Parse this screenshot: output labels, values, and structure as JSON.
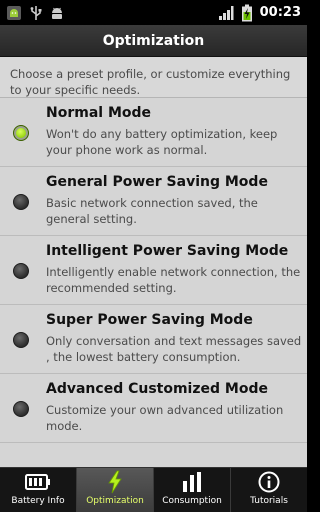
{
  "status_bar": {
    "time": "00:23",
    "left_icons": [
      "android-app-icon",
      "usb-icon",
      "android-debug-icon"
    ],
    "right_icons": [
      "signal-icon",
      "battery-charging-icon"
    ]
  },
  "header": {
    "title": "Optimization"
  },
  "intro_text": "Choose a preset profile, or customize everything to your specific needs.",
  "options": [
    {
      "title": "Normal Mode",
      "description": "Won't do any battery optimization, keep your phone work as normal.",
      "selected": true
    },
    {
      "title": "General Power Saving Mode",
      "description": "Basic network connection saved, the general setting.",
      "selected": false
    },
    {
      "title": "Intelligent Power Saving Mode",
      "description": "Intelligently enable network connection, the recommended setting.",
      "selected": false
    },
    {
      "title": "Super Power Saving Mode",
      "description": "Only conversation and text messages saved , the lowest battery consumption.",
      "selected": false
    },
    {
      "title": "Advanced Customized Mode",
      "description": "Customize your own advanced utilization mode.",
      "selected": false
    }
  ],
  "tabs": [
    {
      "label": "Battery Info",
      "icon": "battery-icon",
      "active": false
    },
    {
      "label": "Optimization",
      "icon": "lightning-icon",
      "active": true
    },
    {
      "label": "Consumption",
      "icon": "bar-chart-icon",
      "active": false
    },
    {
      "label": "Tutorials",
      "icon": "info-icon",
      "active": false
    }
  ],
  "colors": {
    "accent": "#8fcf0a",
    "active_tab_label": "#e6ff6a"
  }
}
